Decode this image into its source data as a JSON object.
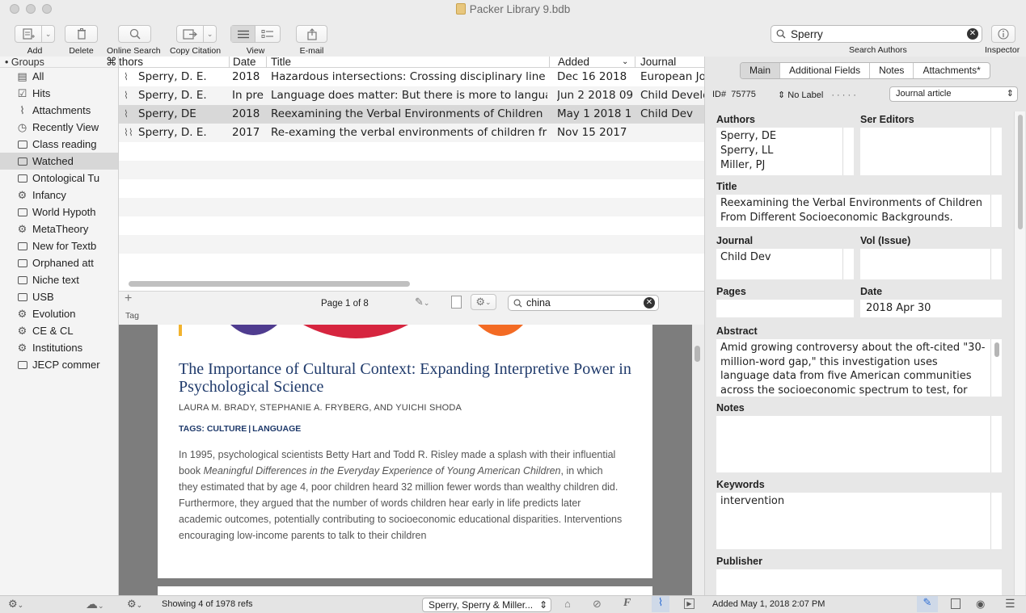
{
  "window": {
    "title": "Packer Library 9.bdb"
  },
  "toolbar": {
    "add": "Add",
    "delete": "Delete",
    "online_search": "Online Search",
    "copy_citation": "Copy Citation",
    "view": "View",
    "email": "E-mail",
    "search_value": "Sperry",
    "search_label": "Search Authors",
    "inspector": "Inspector"
  },
  "sidebar": {
    "header": "Groups",
    "items": [
      {
        "label": "All",
        "icon": "library-icon"
      },
      {
        "label": "Hits",
        "icon": "checkbox-icon"
      },
      {
        "label": "Attachments",
        "icon": "paperclip-icon"
      },
      {
        "label": "Recently View",
        "icon": "clock-icon"
      },
      {
        "label": "Class reading",
        "icon": "folder-icon"
      },
      {
        "label": "Watched",
        "icon": "folder-icon"
      },
      {
        "label": "Ontological Tu",
        "icon": "folder-icon"
      },
      {
        "label": "Infancy",
        "icon": "gear-icon"
      },
      {
        "label": "World Hypoth",
        "icon": "folder-icon"
      },
      {
        "label": "MetaTheory",
        "icon": "gear-icon"
      },
      {
        "label": "New for Textb",
        "icon": "folder-icon"
      },
      {
        "label": "Orphaned att",
        "icon": "folder-icon"
      },
      {
        "label": "Niche text",
        "icon": "folder-icon"
      },
      {
        "label": "USB",
        "icon": "folder-icon"
      },
      {
        "label": "Evolution",
        "icon": "gear-icon"
      },
      {
        "label": "CE & CL",
        "icon": "gear-icon"
      },
      {
        "label": "Institutions",
        "icon": "gear-icon"
      },
      {
        "label": "JECP commer",
        "icon": "folder-icon"
      }
    ]
  },
  "reflist": {
    "columns": {
      "shortcut": "⌘",
      "authors": "thors",
      "date": "Date",
      "title": "Title",
      "added": "Added",
      "journal": "Journal"
    },
    "rows": [
      {
        "author": "Sperry, D. E.",
        "date": "2018",
        "title": "Hazardous intersections: Crossing disciplinary line",
        "added": "Dec 16 2018",
        "journal": "European Jo"
      },
      {
        "author": "Sperry, D. E.",
        "date": "In pre",
        "title": "Language does matter: But there is more to langua",
        "added": "Jun 2 2018 09",
        "journal": "Child Develo"
      },
      {
        "author": "Sperry, DE",
        "date": "2018",
        "title": "Reexamining the Verbal Environments of Children",
        "added": "May 1 2018 1",
        "journal": "Child Dev"
      },
      {
        "author": "Sperry, D. E.",
        "date": "2017",
        "title": "Re-examing the verbal environments of children fr",
        "added": "Nov 15 2017",
        "journal": ""
      }
    ]
  },
  "pdfbar": {
    "page": "Page 1 of 8",
    "search_value": "china",
    "tag_label": "Tag",
    "add": "+"
  },
  "article": {
    "title": "The Importance of Cultural Context: Expanding Interpretive Power in Psychological Science",
    "authors": "LAURA M. BRADY, STEPHANIE A. FRYBERG, AND YUICHI SHODA",
    "tags_label": "TAGS:",
    "tag1": "CULTURE",
    "tag2": "LANGUAGE",
    "body_1": "In 1995, psychological scientists Betty Hart and Todd R. Risley made a splash with their influential book ",
    "body_italic": "Meaningful Differences in the Everyday Experience of Young American Children",
    "body_2": ", in which they estimated that by age 4, poor children heard 32 million fewer words than wealthy children did. Furthermore, they argued that the number of words children hear early in life predicts later academic outcomes, potentially contributing to socioeconomic educational disparities. Interventions encouraging low-income parents to talk to their children"
  },
  "inspector": {
    "tabs": [
      "Main",
      "Additional Fields",
      "Notes",
      "Attachments*"
    ],
    "id_label": "ID#",
    "id": "75775",
    "label_select": "No Label",
    "dots": "· · · · ·",
    "type": "Journal article",
    "fields": {
      "authors_label": "Authors",
      "authors": [
        "Sperry, DE",
        "Sperry, LL",
        "Miller, PJ"
      ],
      "ser_editors_label": "Ser Editors",
      "title_label": "Title",
      "title": "Reexamining the Verbal Environments of Children From Different Socioeconomic Backgrounds.",
      "journal_label": "Journal",
      "journal": "Child Dev",
      "vol_label": "Vol (Issue)",
      "pages_label": "Pages",
      "date_label": "Date",
      "date": "2018 Apr 30",
      "abstract_label": "Abstract",
      "abstract": "Amid growing controversy about the oft-cited \"30-million-word gap,\" this investigation uses language data from five American communities across the socioeconomic spectrum to test, for the first time, Hart",
      "notes_label": "Notes",
      "keywords_label": "Keywords",
      "keywords": "intervention",
      "publisher_label": "Publisher"
    }
  },
  "statusbar": {
    "showing": "Showing 4 of 1978 refs",
    "authors_popup": "Sperry, Sperry & Miller...",
    "added": "Added May 1, 2018 2:07 PM"
  }
}
